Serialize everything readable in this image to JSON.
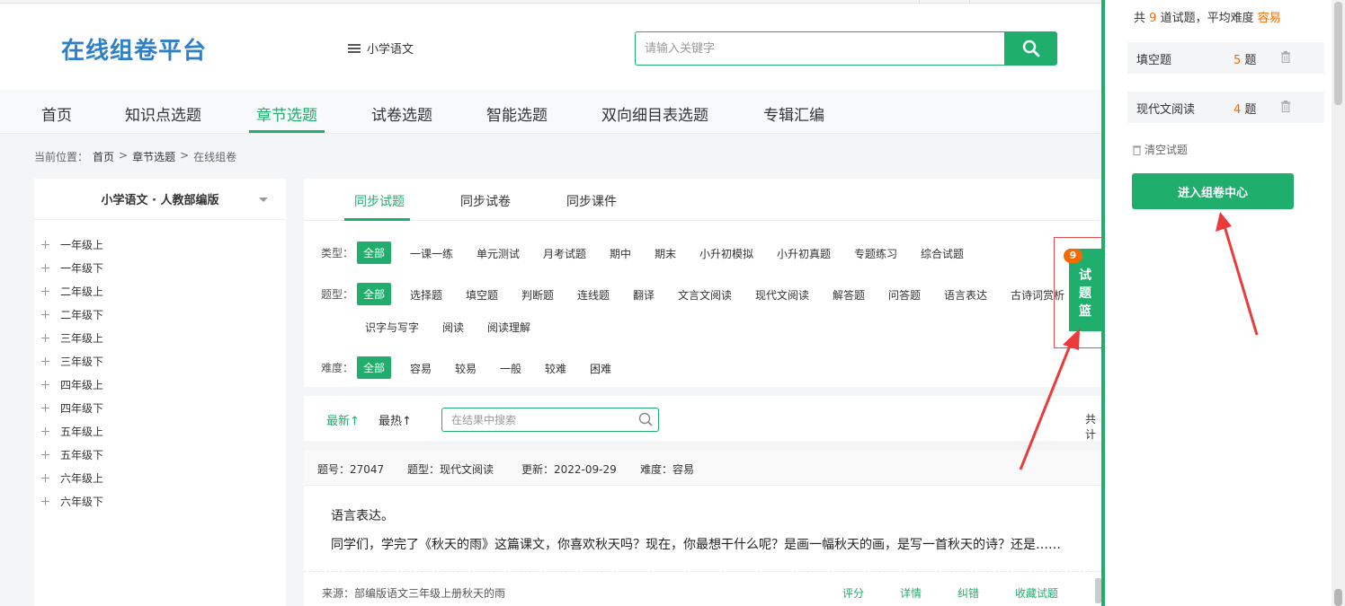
{
  "header": {
    "logo": "在线组卷平台",
    "subject": "小学语文",
    "search_placeholder": "请输入关键字"
  },
  "nav": [
    "首页",
    "知识点选题",
    "章节选题",
    "试卷选题",
    "智能选题",
    "双向细目表选题",
    "专辑汇编"
  ],
  "breadcrumb": {
    "label": "当前位置：",
    "home": "首页",
    "sep": ">",
    "section": "章节选题",
    "page": "在线组卷"
  },
  "left_panel": {
    "title": "小学语文 · 人教部编版",
    "grades": [
      "一年级上",
      "一年级下",
      "二年级上",
      "二年级下",
      "三年级上",
      "三年级下",
      "四年级上",
      "四年级下",
      "五年级上",
      "五年级下",
      "六年级上",
      "六年级下"
    ]
  },
  "tabs": [
    "同步试题",
    "同步试卷",
    "同步课件"
  ],
  "filters": {
    "type_label": "类型：",
    "types": [
      "全部",
      "一课一练",
      "单元测试",
      "月考试题",
      "期中",
      "期末",
      "小升初模拟",
      "小升初真题",
      "专题练习",
      "综合试题"
    ],
    "qtype_label": "题型：",
    "qtypes": [
      "全部",
      "选择题",
      "填空题",
      "判断题",
      "连线题",
      "翻译",
      "文言文阅读",
      "现代文阅读",
      "解答题",
      "问答题",
      "语言表达",
      "古诗词赏析",
      "识字与写字",
      "阅读",
      "阅读理解"
    ],
    "difficulty_label": "难度：",
    "difficulties": [
      "全部",
      "容易",
      "较易",
      "一般",
      "较难",
      "困难"
    ]
  },
  "sortbar": {
    "latest": "最新↑",
    "hottest": "最热↑",
    "search_placeholder": "在结果中搜索",
    "total": "共计"
  },
  "question": {
    "id": "题号：27047",
    "type": "题型：现代文阅读",
    "updated": "更新：2022-09-29",
    "difficulty": "难度：容易",
    "line1": "语言表达。",
    "line2": "同学们，学完了《秋天的雨》这篇课文，你喜欢秋天吗？现在，你最想干什么呢？是画一幅秋天的画，是写一首秋天的诗？还是……",
    "source": "来源：部编版语文三年级上册秋天的雨",
    "actions": [
      "评分",
      "详情",
      "纠错",
      "收藏试题"
    ]
  },
  "basket": {
    "count": "9",
    "label": [
      "试",
      "题",
      "篮"
    ]
  },
  "side_panel": {
    "summary_prefix": "共",
    "count": "9",
    "summary_mid": "道试题，平均难度",
    "avg": "容易",
    "rows": [
      {
        "name": "填空题",
        "count": "5",
        "unit": "题"
      },
      {
        "name": "现代文阅读",
        "count": "4",
        "unit": "题"
      }
    ],
    "clear": "清空试题",
    "enter": "进入组卷中心"
  },
  "colors": {
    "accent": "#1fae6c",
    "logo": "#2f80c8",
    "highlight": "#f56a00",
    "annotation": "#e04a4a"
  }
}
